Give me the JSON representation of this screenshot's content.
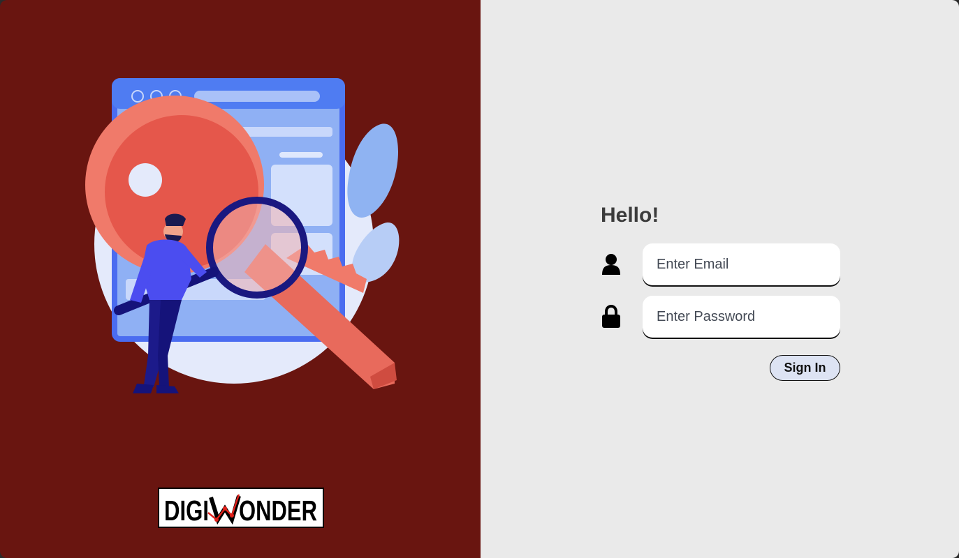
{
  "brand": {
    "logo_text_left": "DIGI",
    "logo_text_right": "ONDER",
    "logo_accent_color": "#e0201a"
  },
  "colors": {
    "left_panel_bg": "#691510",
    "right_panel_bg": "#eaeaea",
    "button_bg": "#dde3f3"
  },
  "login": {
    "greeting": "Hello!",
    "email": {
      "placeholder": "Enter Email",
      "value": "",
      "icon": "user-icon"
    },
    "password": {
      "placeholder": "Enter Password",
      "value": "",
      "icon": "lock-icon"
    },
    "sign_in_label": "Sign In"
  }
}
